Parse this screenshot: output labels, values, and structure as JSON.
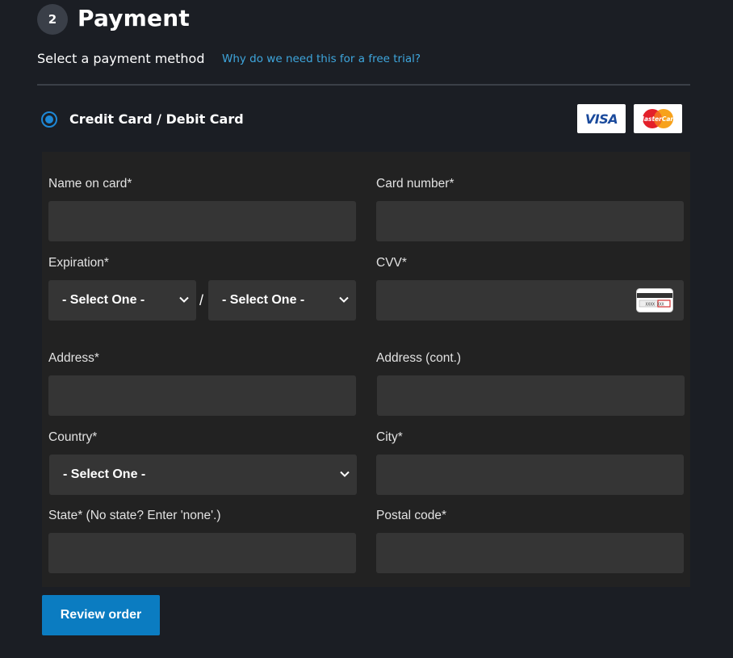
{
  "header": {
    "step_number": "2",
    "title": "Payment"
  },
  "payment_method": {
    "subtitle": "Select a payment method",
    "help_link": "Why do we need this for a free trial?",
    "option_label": "Credit Card / Debit Card",
    "selected": true,
    "logos": [
      "VISA",
      "MasterCard"
    ]
  },
  "form": {
    "name_on_card": {
      "label": "Name on card*",
      "value": ""
    },
    "card_number": {
      "label": "Card number*",
      "value": ""
    },
    "expiration": {
      "label": "Expiration*",
      "month_value": "- Select One -",
      "year_value": "- Select One -",
      "separator": "/"
    },
    "cvv": {
      "label": "CVV*",
      "value": "",
      "icon_text": "XXXX XXX"
    },
    "address": {
      "label": "Address*",
      "value": ""
    },
    "address_cont": {
      "label": "Address (cont.)",
      "value": ""
    },
    "country": {
      "label": "Country*",
      "value": "- Select One -"
    },
    "city": {
      "label": "City*",
      "value": ""
    },
    "state": {
      "label": "State* (No state? Enter 'none'.)",
      "value": ""
    },
    "postal_code": {
      "label": "Postal code*",
      "value": ""
    }
  },
  "actions": {
    "review_label": "Review order"
  },
  "colors": {
    "background": "#1b1e24",
    "form_background": "#222222",
    "input_background": "#353535",
    "accent": "#1e88d6",
    "link": "#3ea6dd",
    "button": "#0b7cc1"
  }
}
